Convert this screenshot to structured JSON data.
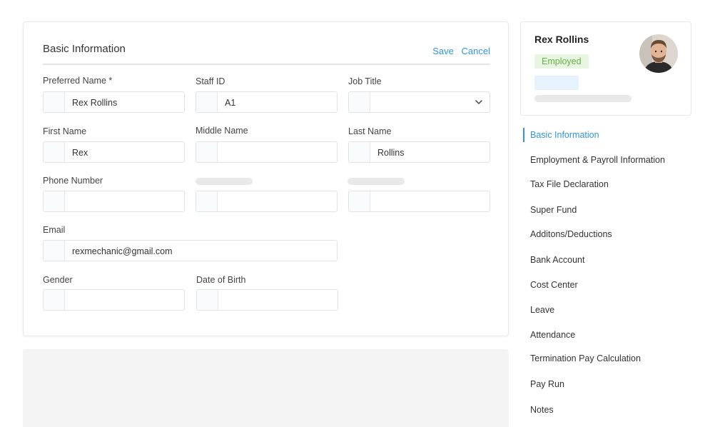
{
  "form": {
    "title": "Basic Information",
    "save_label": "Save",
    "cancel_label": "Cancel",
    "fields": {
      "preferred_name": {
        "label": "Preferred Name *",
        "value": "Rex Rollins"
      },
      "staff_id": {
        "label": "Staff ID",
        "value": "A1"
      },
      "job_title": {
        "label": "Job Title",
        "value": ""
      },
      "first_name": {
        "label": "First Name",
        "value": "Rex"
      },
      "middle_name": {
        "label": "Middle Name",
        "value": ""
      },
      "last_name": {
        "label": "Last Name",
        "value": "Rollins"
      },
      "phone_number": {
        "label": "Phone Number",
        "value": ""
      },
      "email": {
        "label": "Email",
        "value": "rexmechanic@gmail.com"
      },
      "gender": {
        "label": "Gender",
        "value": ""
      },
      "date_of_birth": {
        "label": "Date of Birth",
        "value": ""
      }
    }
  },
  "profile": {
    "name": "Rex Rollins",
    "status": "Employed",
    "status_color": "#6ab04c"
  },
  "nav": {
    "active_color": "#2f95e0",
    "items": [
      "Basic Information",
      "Employment & Payroll Information",
      "Tax File Declaration",
      "Super Fund",
      "Additons/Deductions",
      "Bank Account",
      "Cost Center",
      "Leave",
      "Attendance",
      "Termination Pay Calculation",
      "Pay Run",
      "Notes"
    ]
  }
}
